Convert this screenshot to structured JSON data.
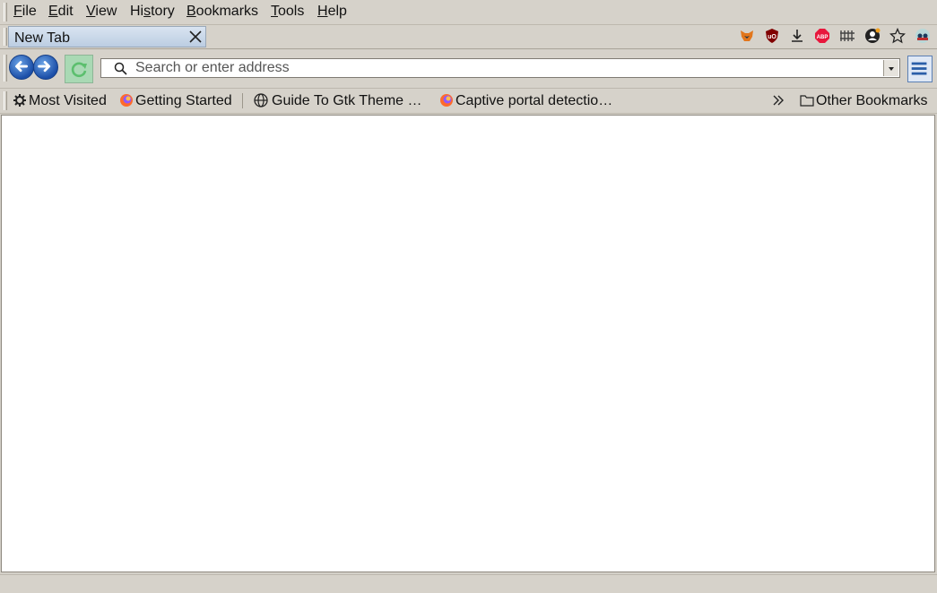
{
  "menubar": {
    "items": [
      {
        "label": "File",
        "mnemonic": "F",
        "rest": "ile"
      },
      {
        "label": "Edit",
        "mnemonic": "E",
        "rest": "dit"
      },
      {
        "label": "View",
        "mnemonic": "V",
        "rest": "iew"
      },
      {
        "label": "History",
        "pre": "Hi",
        "mnemonic": "s",
        "rest": "tory"
      },
      {
        "label": "Bookmarks",
        "mnemonic": "B",
        "rest": "ookmarks"
      },
      {
        "label": "Tools",
        "mnemonic": "T",
        "rest": "ools"
      },
      {
        "label": "Help",
        "mnemonic": "H",
        "rest": "elp"
      }
    ]
  },
  "tabs": [
    {
      "label": "New Tab",
      "active": true
    }
  ],
  "toolbar_icons": [
    "metamask-fox-icon",
    "ublock-origin-icon",
    "download-icon",
    "adblock-plus-icon",
    "library-icon",
    "account-icon",
    "bookmark-star-icon",
    "extension-icon"
  ],
  "navbar": {
    "search_placeholder": "Search or enter address"
  },
  "bookmarks": {
    "items": [
      {
        "label": "Most Visited",
        "icon": "gear-icon"
      },
      {
        "label": "Getting Started",
        "icon": "firefox-icon"
      },
      {
        "label": "Guide To Gtk Theme …",
        "icon": "globe-icon"
      },
      {
        "label": "Captive portal detectio…",
        "icon": "firefox-icon"
      }
    ],
    "other": "Other Bookmarks"
  },
  "colors": {
    "chrome_bg": "#d6d2ca",
    "tab_active": "#c8d7ea",
    "nav_blue": "#1c4fa8",
    "reload_green": "#a9d9b4"
  }
}
